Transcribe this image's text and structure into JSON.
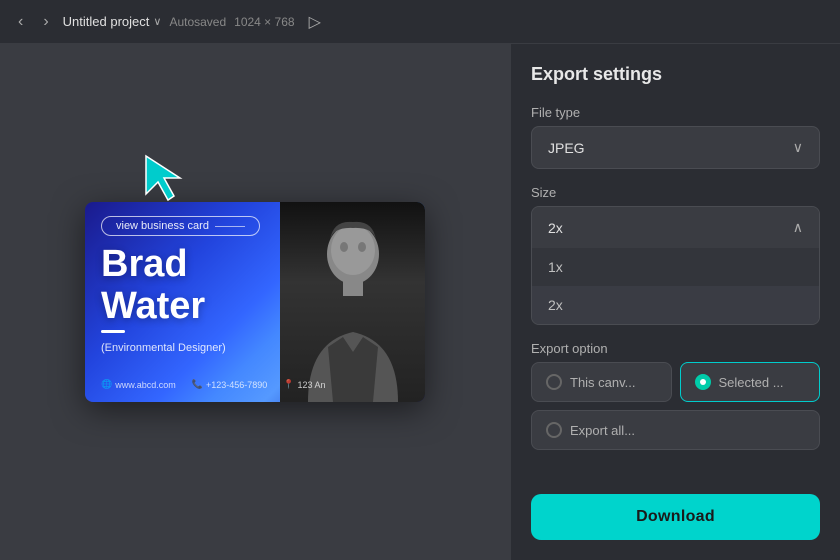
{
  "topbar": {
    "back_label": "‹",
    "forward_label": "›",
    "project_name": "Untitled project",
    "project_chevron": "∨",
    "autosaved": "Autosaved",
    "resolution": "1024 × 768",
    "share_icon": "▷"
  },
  "canvas": {
    "card": {
      "view_label": "view business card",
      "name_line1": "Brad",
      "name_line2": "Water",
      "job_title": "(Environmental Designer)",
      "website": "www.abcd.com",
      "phone": "+123-456-7890",
      "address": "123 An"
    }
  },
  "export_panel": {
    "title": "Export settings",
    "file_type_label": "File type",
    "file_type_value": "JPEG",
    "file_type_chevron": "∨",
    "size_label": "Size",
    "size_value": "2x",
    "size_chevron": "∧",
    "size_options": [
      "1x",
      "2x"
    ],
    "export_option_label": "Export option",
    "this_canvas_label": "This canv...",
    "selected_label": "Selected ...",
    "export_all_label": "Export all...",
    "download_label": "Download"
  }
}
